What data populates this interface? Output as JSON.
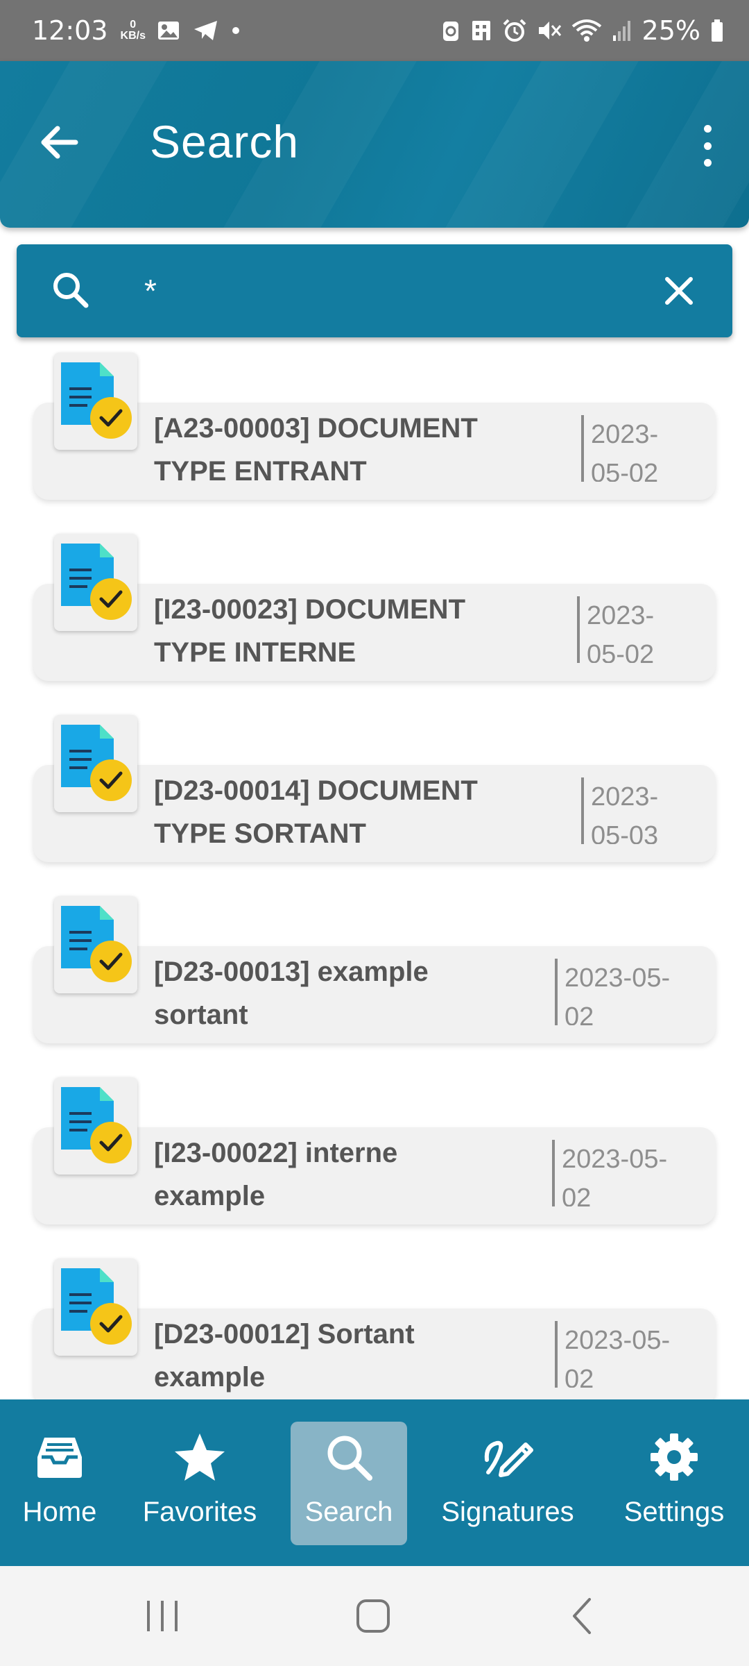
{
  "status_bar": {
    "time": "12:03",
    "net_speed_value": "0",
    "net_speed_unit": "KB/s",
    "battery": "25%",
    "left_icons": [
      "gallery-icon",
      "telegram-icon",
      "dot-icon"
    ],
    "right_icons": [
      "recycle-icon",
      "building-icon",
      "alarm-icon",
      "mute-icon",
      "wifi-icon",
      "signal-icon",
      "battery-icon"
    ]
  },
  "app_bar": {
    "title": "Search"
  },
  "search": {
    "value": "*"
  },
  "results": [
    {
      "title_line1": "[A23-00003] DOCUMENT",
      "title_line2": "TYPE ENTRANT",
      "date_line1": "2023-",
      "date_line2": "05-02"
    },
    {
      "title_line1": "[I23-00023] DOCUMENT",
      "title_line2": "TYPE INTERNE",
      "date_line1": "2023-",
      "date_line2": "05-02"
    },
    {
      "title_line1": "[D23-00014] DOCUMENT",
      "title_line2": "TYPE SORTANT",
      "date_line1": "2023-",
      "date_line2": "05-03"
    },
    {
      "title_line1": "[D23-00013] example",
      "title_line2": "sortant",
      "date_line1": "2023-05-",
      "date_line2": "02"
    },
    {
      "title_line1": "[I23-00022] interne",
      "title_line2": "example",
      "date_line1": "2023-05-",
      "date_line2": "02"
    },
    {
      "title_line1": "[D23-00012] Sortant",
      "title_line2": "example",
      "date_line1": "2023-05-",
      "date_line2": "02"
    }
  ],
  "bottom_nav": [
    {
      "label": "Home",
      "icon": "inbox-icon"
    },
    {
      "label": "Favorites",
      "icon": "star-icon"
    },
    {
      "label": "Search",
      "icon": "search-icon",
      "active": true
    },
    {
      "label": "Signatures",
      "icon": "signature-icon"
    },
    {
      "label": "Settings",
      "icon": "gear-icon"
    }
  ],
  "colors": {
    "primary": "#137ca0",
    "status_bar": "#737373",
    "card_bg": "#f1f1f1",
    "doc_blue": "#19a8e6",
    "check_yellow": "#f5c518",
    "active_nav": "#88b4c6"
  }
}
